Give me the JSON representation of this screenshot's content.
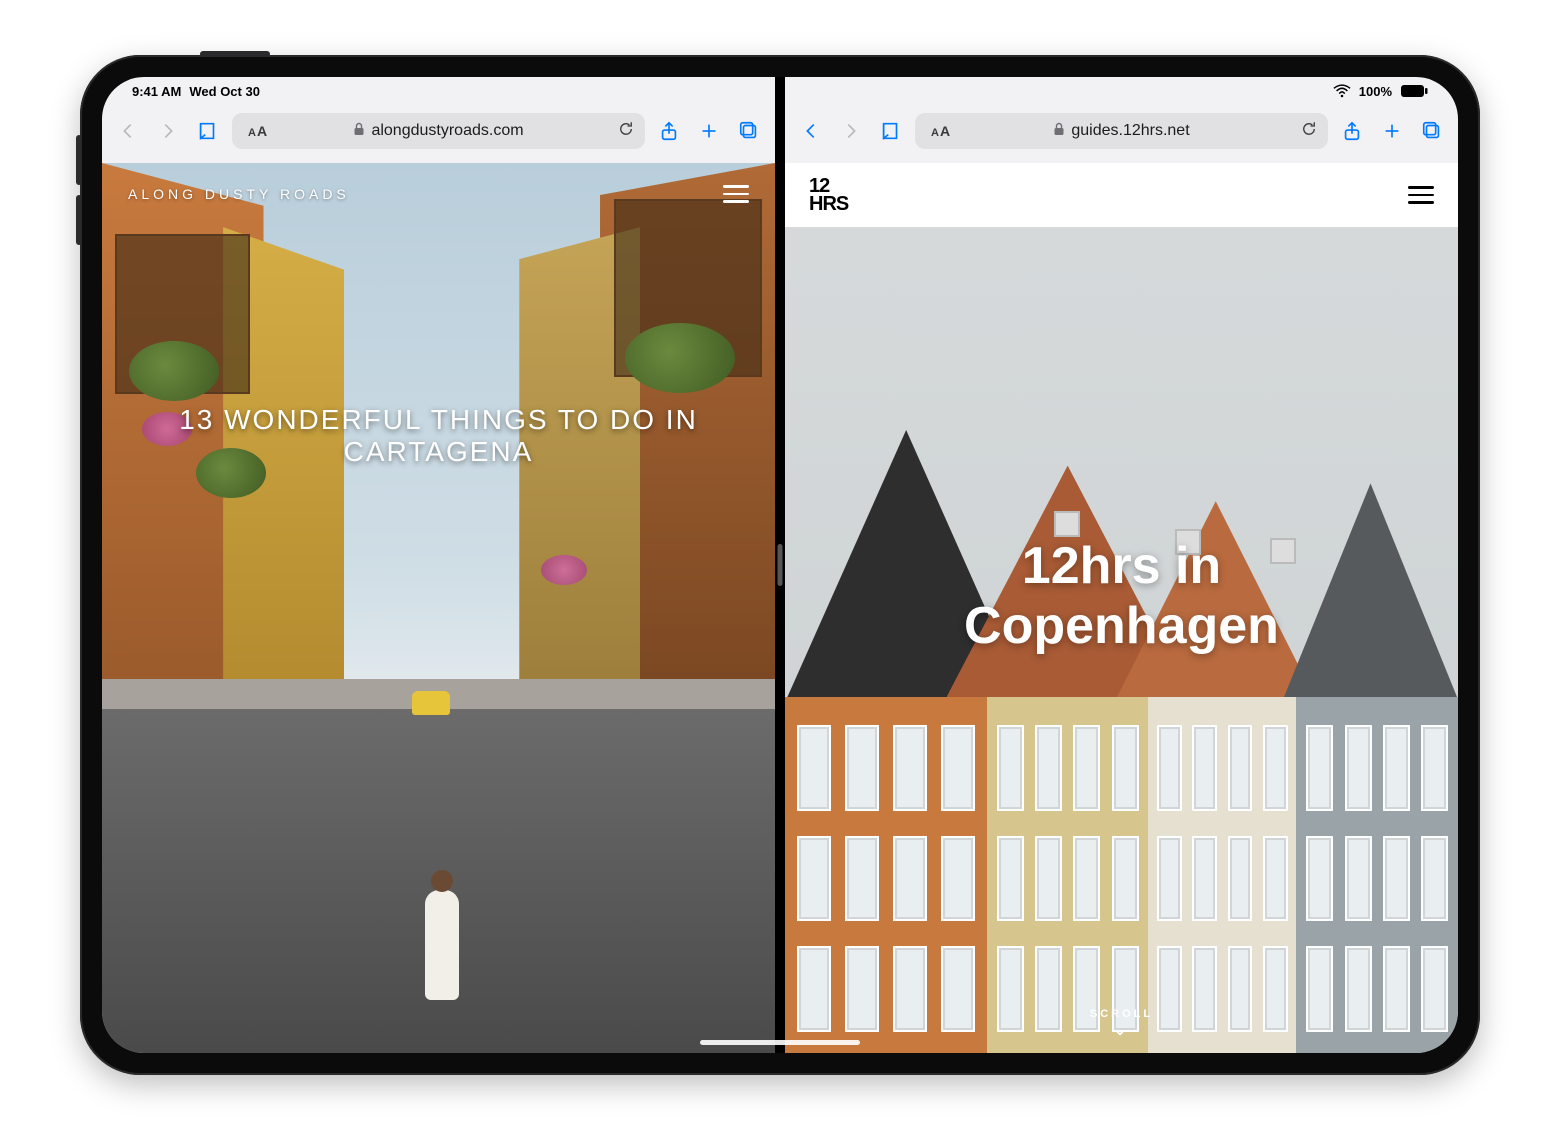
{
  "status": {
    "time": "9:41 AM",
    "date": "Wed Oct 30",
    "battery_percent": "100%"
  },
  "left": {
    "toolbar": {
      "url": "alongdustyroads.com",
      "aa": "AA"
    },
    "site": {
      "brand": "ALONG DUSTY ROADS",
      "hero_title": "13 WONDERFUL THINGS TO DO IN CARTAGENA"
    }
  },
  "right": {
    "toolbar": {
      "url": "guides.12hrs.net",
      "aa": "AA"
    },
    "site": {
      "logo_line1": "12",
      "logo_line2": "HRS",
      "hero_line1": "12hrs in",
      "hero_line2": "Copenhagen",
      "scroll_hint": "SCROLL"
    }
  }
}
